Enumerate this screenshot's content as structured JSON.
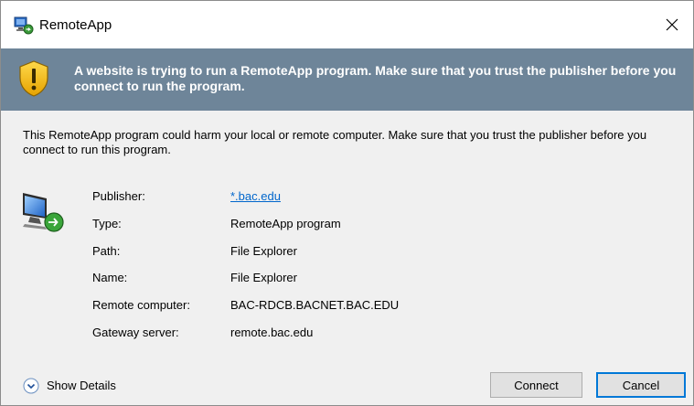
{
  "window": {
    "title": "RemoteApp",
    "close_glyph": "✕"
  },
  "banner": {
    "text": "A website is trying to run a RemoteApp program. Make sure that you trust the publisher before you connect to run the program.",
    "icon": "shield-warning-icon"
  },
  "description": "This RemoteApp program could harm your local or remote computer. Make sure that you trust the publisher before you connect to run this program.",
  "info": {
    "icon": "remote-computer-icon",
    "rows": [
      {
        "label": "Publisher:",
        "value": "*.bac.edu",
        "is_link": true
      },
      {
        "label": "Type:",
        "value": "RemoteApp program"
      },
      {
        "label": "Path:",
        "value": "File Explorer"
      },
      {
        "label": "Name:",
        "value": "File Explorer"
      },
      {
        "label": "Remote computer:",
        "value": "BAC-RDCB.BACNET.BAC.EDU"
      },
      {
        "label": "Gateway server:",
        "value": "remote.bac.edu"
      }
    ]
  },
  "footer": {
    "show_details_label": "Show Details",
    "connect_label": "Connect",
    "cancel_label": "Cancel"
  },
  "colors": {
    "banner_bg": "#6e8599",
    "link": "#0066cc",
    "focus_border": "#0078d7",
    "dialog_bg": "#f0f0f0"
  }
}
